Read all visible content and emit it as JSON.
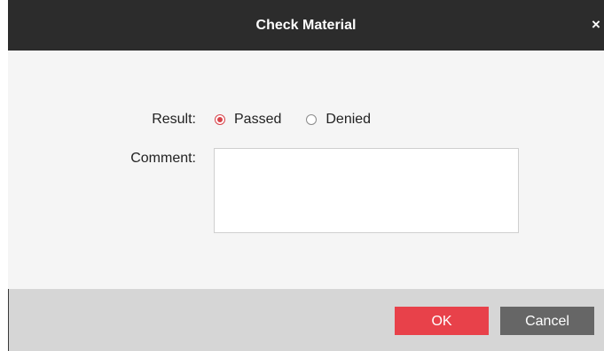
{
  "dialog": {
    "title": "Check Material",
    "close_symbol": "×"
  },
  "form": {
    "result_label": "Result:",
    "comment_label": "Comment:",
    "options": [
      {
        "label": "Passed",
        "checked": true
      },
      {
        "label": "Denied",
        "checked": false
      }
    ],
    "comment_value": ""
  },
  "footer": {
    "ok_label": "OK",
    "cancel_label": "Cancel"
  },
  "colors": {
    "titlebar": "#2c2c2c",
    "accent": "#e8414a",
    "cancel": "#666666",
    "footer": "#d6d6d6",
    "body": "#f5f5f5"
  },
  "icons": {
    "close": "close-icon",
    "radio_checked": "radio-checked-icon",
    "radio_unchecked": "radio-unchecked-icon"
  }
}
